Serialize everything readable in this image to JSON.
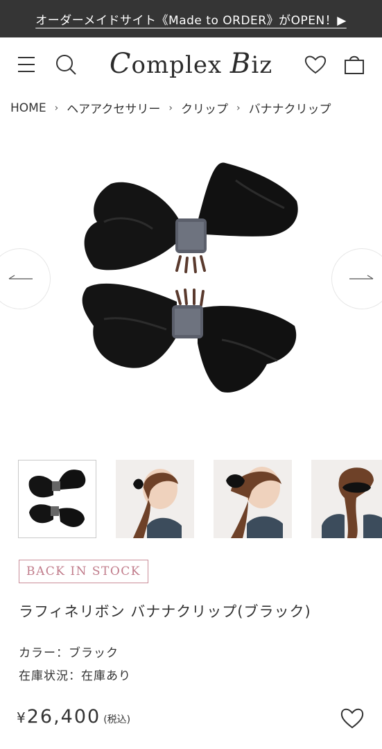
{
  "announcement": {
    "text": "オーダーメイドサイト《Made to ORDER》がOPEN！▶"
  },
  "header": {
    "logo_big_c": "C",
    "logo_mid": "omplex ",
    "logo_big_b": "B",
    "logo_end": "iz",
    "icons": [
      "menu-icon",
      "search-icon",
      "heart-icon",
      "cart-icon"
    ]
  },
  "breadcrumb": {
    "items": [
      "HOME",
      "ヘアアクセサリー",
      "クリップ",
      "バナナクリップ"
    ],
    "separator": "›"
  },
  "gallery": {
    "prev_icon": "arrow-left-icon",
    "next_icon": "arrow-right-icon",
    "thumbnail_count": 4,
    "active_index": 0
  },
  "product": {
    "badge": "BACK IN STOCK",
    "title": "ラフィネリボン バナナクリップ(ブラック)",
    "color_line": "カラー：ブラック",
    "stock_line": "在庫状況：在庫あり",
    "price_symbol": "¥",
    "price": "26,400",
    "tax_note": "(税込)"
  },
  "colors": {
    "topbar_bg": "#353535",
    "badge_accent": "#c98c98",
    "text": "#333333"
  }
}
